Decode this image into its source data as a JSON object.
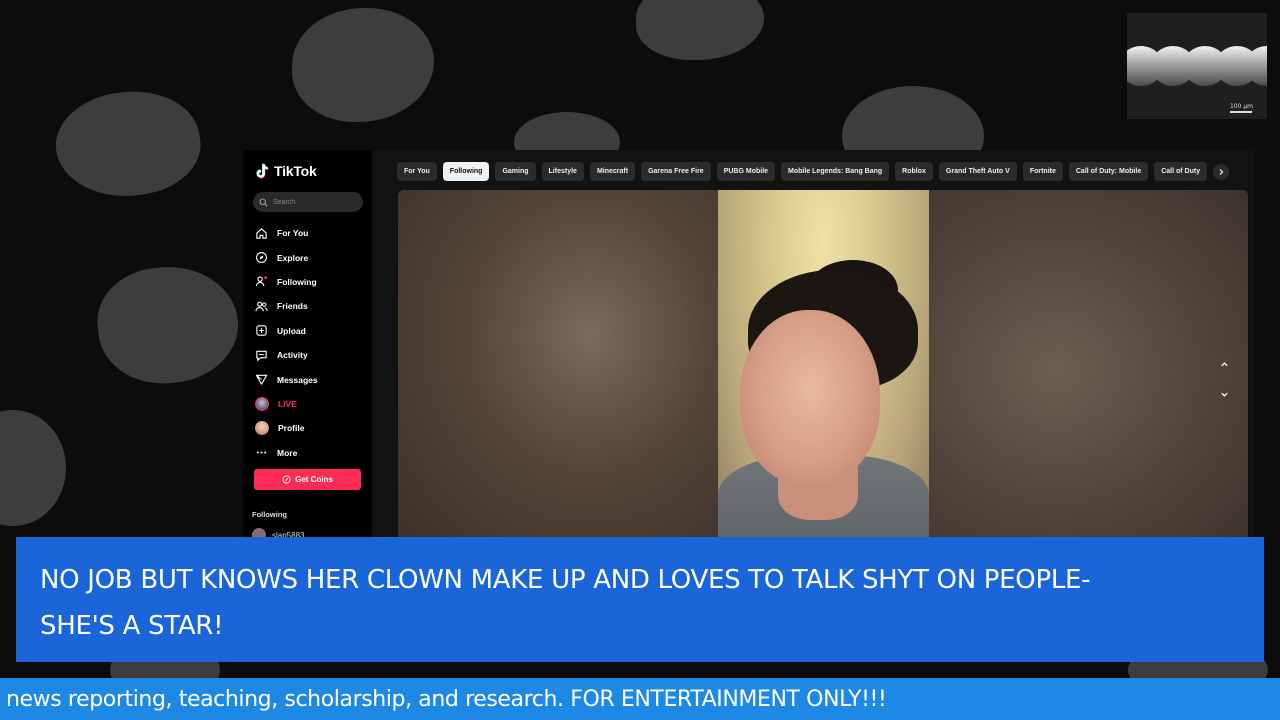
{
  "tiktok": {
    "logo_text": "TikTok",
    "search_placeholder": "Search",
    "nav": [
      {
        "label": "For You",
        "icon": "home-icon"
      },
      {
        "label": "Explore",
        "icon": "compass-icon"
      },
      {
        "label": "Following",
        "icon": "user-plus-icon"
      },
      {
        "label": "Friends",
        "icon": "users-icon"
      },
      {
        "label": "Upload",
        "icon": "plus-square-icon"
      },
      {
        "label": "Activity",
        "icon": "message-square-icon"
      },
      {
        "label": "Messages",
        "icon": "send-icon"
      },
      {
        "label": "LIVE",
        "icon": "live-avatar-icon"
      },
      {
        "label": "Profile",
        "icon": "profile-avatar-icon"
      },
      {
        "label": "More",
        "icon": "more-dots-icon"
      }
    ],
    "get_coins_label": "Get Coins",
    "following_title": "Following",
    "following_user": "slap5883",
    "categories": [
      "For You",
      "Following",
      "Gaming",
      "Lifestyle",
      "Minecraft",
      "Garena Free Fire",
      "PUBG Mobile",
      "Mobile Legends: Bang Bang",
      "Roblox",
      "Grand Theft Auto V",
      "Fortnite",
      "Call of Duty: Mobile",
      "Call of Duty"
    ],
    "active_category": "Following",
    "accent_color": "#fe2c55"
  },
  "thumbnail": {
    "scale_label": "100 µm"
  },
  "banner": {
    "text": "NO JOB BUT KNOWS HER CLOWN MAKE UP AND LOVES TO TALK SHYT ON PEOPLE-SHE'S A STAR!",
    "color": "#1a65d8"
  },
  "ticker": {
    "text": "news reporting, teaching, scholarship, and research. FOR ENTERTAINMENT ONLY!!!",
    "color": "#1e88e5"
  }
}
